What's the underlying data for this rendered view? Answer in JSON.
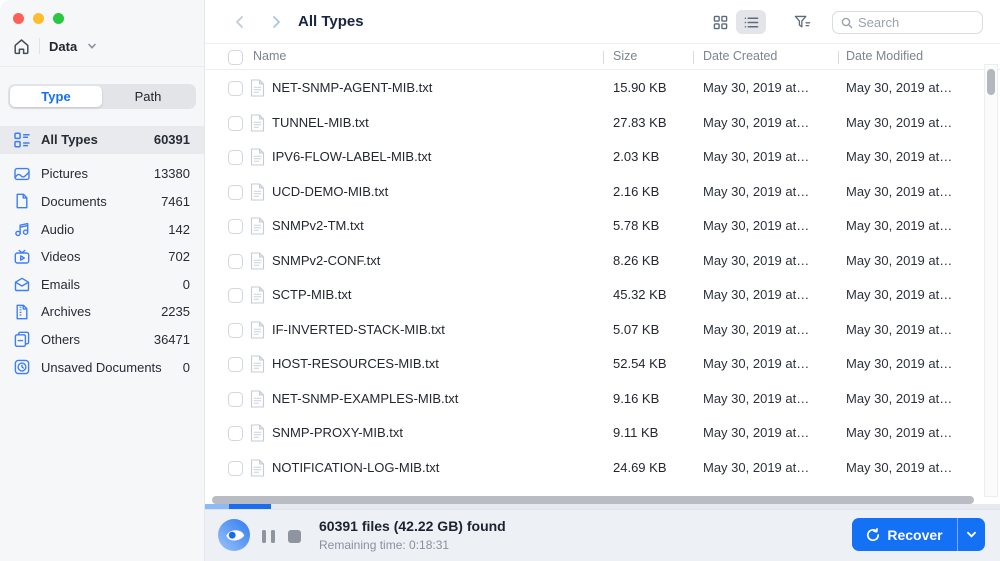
{
  "colors": {
    "accent": "#1470f4",
    "icon-blue": "#3f7ef2",
    "progress-light": "#8db9f7",
    "progress-dark": "#1c6cf2",
    "traffic-red": "#ff5f57",
    "traffic-yellow": "#febc2e",
    "traffic-green": "#28c840"
  },
  "titlebar": {
    "breadcrumb": "Data"
  },
  "sidebar": {
    "tabs": [
      {
        "label": "Type",
        "active": true
      },
      {
        "label": "Path",
        "active": false
      }
    ],
    "items": [
      {
        "icon": "all-types-icon",
        "label": "All Types",
        "count": "60391",
        "selected": true
      },
      {
        "icon": "pictures-icon",
        "label": "Pictures",
        "count": "13380"
      },
      {
        "icon": "documents-icon",
        "label": "Documents",
        "count": "7461"
      },
      {
        "icon": "audio-icon",
        "label": "Audio",
        "count": "142"
      },
      {
        "icon": "videos-icon",
        "label": "Videos",
        "count": "702"
      },
      {
        "icon": "emails-icon",
        "label": "Emails",
        "count": "0"
      },
      {
        "icon": "archives-icon",
        "label": "Archives",
        "count": "2235"
      },
      {
        "icon": "others-icon",
        "label": "Others",
        "count": "36471"
      },
      {
        "icon": "unsaved-icon",
        "label": "Unsaved Documents",
        "count": "0"
      }
    ]
  },
  "toolbar": {
    "title": "All Types",
    "search_placeholder": "Search"
  },
  "table": {
    "columns": {
      "name": "Name",
      "size": "Size",
      "created": "Date Created",
      "modified": "Date Modified"
    },
    "rows": [
      {
        "name": "NET-SNMP-AGENT-MIB.txt",
        "size": "15.90 KB",
        "created": "May 30, 2019 at…",
        "modified": "May 30, 2019 at…"
      },
      {
        "name": "TUNNEL-MIB.txt",
        "size": "27.83 KB",
        "created": "May 30, 2019 at…",
        "modified": "May 30, 2019 at…"
      },
      {
        "name": "IPV6-FLOW-LABEL-MIB.txt",
        "size": "2.03 KB",
        "created": "May 30, 2019 at…",
        "modified": "May 30, 2019 at…"
      },
      {
        "name": "UCD-DEMO-MIB.txt",
        "size": "2.16 KB",
        "created": "May 30, 2019 at…",
        "modified": "May 30, 2019 at…"
      },
      {
        "name": "SNMPv2-TM.txt",
        "size": "5.78 KB",
        "created": "May 30, 2019 at…",
        "modified": "May 30, 2019 at…"
      },
      {
        "name": "SNMPv2-CONF.txt",
        "size": "8.26 KB",
        "created": "May 30, 2019 at…",
        "modified": "May 30, 2019 at…"
      },
      {
        "name": "SCTP-MIB.txt",
        "size": "45.32 KB",
        "created": "May 30, 2019 at…",
        "modified": "May 30, 2019 at…"
      },
      {
        "name": "IF-INVERTED-STACK-MIB.txt",
        "size": "5.07 KB",
        "created": "May 30, 2019 at…",
        "modified": "May 30, 2019 at…"
      },
      {
        "name": "HOST-RESOURCES-MIB.txt",
        "size": "52.54 KB",
        "created": "May 30, 2019 at…",
        "modified": "May 30, 2019 at…"
      },
      {
        "name": "NET-SNMP-EXAMPLES-MIB.txt",
        "size": "9.16 KB",
        "created": "May 30, 2019 at…",
        "modified": "May 30, 2019 at…"
      },
      {
        "name": "SNMP-PROXY-MIB.txt",
        "size": "9.11 KB",
        "created": "May 30, 2019 at…",
        "modified": "May 30, 2019 at…"
      },
      {
        "name": "NOTIFICATION-LOG-MIB.txt",
        "size": "24.69 KB",
        "created": "May 30, 2019 at…",
        "modified": "May 30, 2019 at…"
      }
    ]
  },
  "statusbar": {
    "found": "60391 files (42.22 GB) found",
    "remaining": "Remaining time: 0:18:31",
    "recover_label": "Recover"
  }
}
